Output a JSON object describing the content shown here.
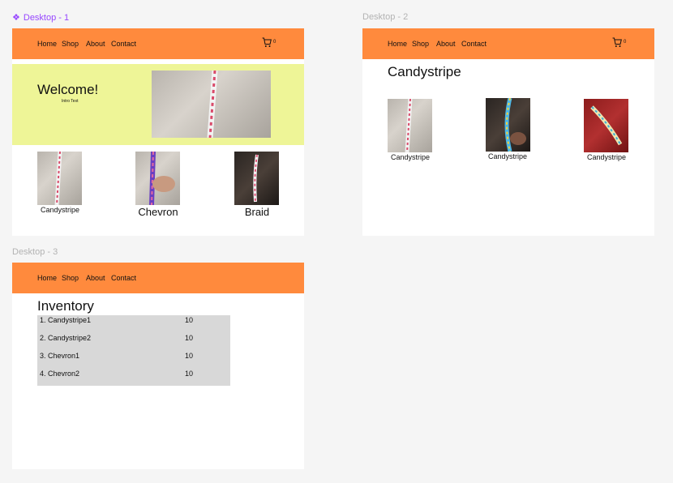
{
  "frames": {
    "desktop1": {
      "label": "Desktop - 1"
    },
    "desktop2": {
      "label": "Desktop - 2"
    },
    "desktop3": {
      "label": "Desktop - 3"
    }
  },
  "nav": {
    "home": "Home",
    "shop": "Shop",
    "about": "About",
    "contact": "Contact",
    "cart_count": "0"
  },
  "desktop1": {
    "hero_title": "Welcome!",
    "hero_subtitle": "Intro Text",
    "products": [
      "Candystripe",
      "Chevron",
      "Braid"
    ]
  },
  "desktop2": {
    "page_title": "Candystripe",
    "products": [
      "Candystripe",
      "Candystripe",
      "Candystripe"
    ]
  },
  "desktop3": {
    "page_title": "Inventory",
    "inventory": [
      {
        "name": "1. Candystripe1",
        "qty": "10"
      },
      {
        "name": "2. Candystripe2",
        "qty": "10"
      },
      {
        "name": "3. Chevron1",
        "qty": "10"
      },
      {
        "name": "4. Chevron2",
        "qty": "10"
      }
    ]
  },
  "colors": {
    "nav_bg": "#ff8a3d",
    "hero_bg": "#eef597",
    "selected_frame_label": "#9747ff",
    "table_bg": "#d8d8d8"
  }
}
